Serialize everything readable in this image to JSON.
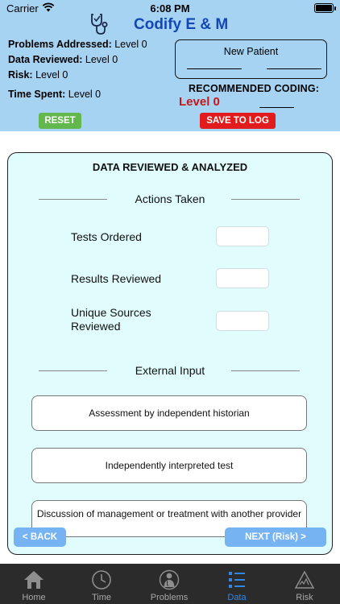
{
  "status_bar": {
    "carrier": "Carrier",
    "time": "6:08 PM"
  },
  "app": {
    "title": "Codify E & M"
  },
  "levels": {
    "problems": {
      "label": "Problems Addressed:",
      "value": "Level 0"
    },
    "data": {
      "label": "Data Reviewed:",
      "value": "Level 0"
    },
    "risk": {
      "label": "Risk:",
      "value": "Level 0"
    },
    "time": {
      "label": "Time Spent:",
      "value": "Level 0"
    }
  },
  "patient": {
    "label": "New Patient"
  },
  "coding": {
    "label": "RECOMMENDED CODING:",
    "value": "Level 0"
  },
  "buttons": {
    "reset": "RESET",
    "save": "SAVE TO LOG"
  },
  "panel": {
    "title": "DATA REVIEWED & ANALYZED",
    "actions": {
      "heading": "Actions Taken",
      "rows": [
        {
          "label": "Tests Ordered"
        },
        {
          "label": "Results Reviewed"
        },
        {
          "label": "Unique Sources Reviewed"
        }
      ]
    },
    "external": {
      "heading": "External Input",
      "items": [
        "Assessment by independent historian",
        "Independently interpreted test",
        "Discussion of management or treatment with another provider"
      ]
    },
    "nav": {
      "back": "< BACK",
      "next": "NEXT (Risk) >"
    }
  },
  "tabbar": {
    "items": [
      {
        "label": "Home",
        "icon": "home-icon"
      },
      {
        "label": "Time",
        "icon": "clock-icon"
      },
      {
        "label": "Problems",
        "icon": "doctor-icon"
      },
      {
        "label": "Data",
        "icon": "list-icon",
        "active": true
      },
      {
        "label": "Risk",
        "icon": "warning-icon"
      }
    ],
    "active_color": "#2f87e8"
  },
  "colors": {
    "header_bg": "#a7d3f3",
    "panel_bg": "#e1fcfd",
    "title_blue": "#1447b3",
    "coding_red": "#c21818",
    "reset_green": "#62b84c",
    "save_red": "#e21c1c",
    "nav_blue": "#76b3f2"
  }
}
